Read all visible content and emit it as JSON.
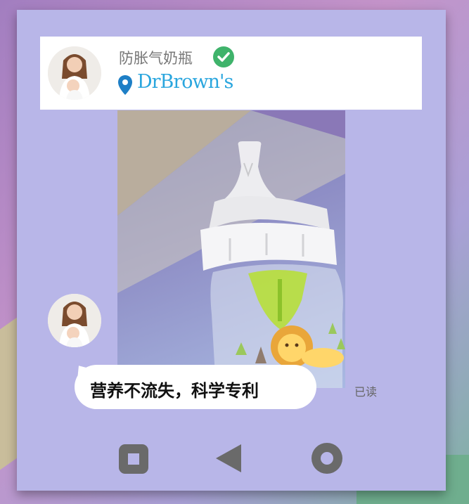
{
  "header": {
    "title": "防胀气奶瓶",
    "brand": "DrBrown's"
  },
  "message": {
    "text": "营养不流失，科学专利",
    "status": "已读"
  },
  "icons": {
    "verified": "check-circle-icon",
    "location": "location-pin-icon",
    "nav": [
      "square-icon",
      "back-triangle-icon",
      "home-circle-icon"
    ]
  },
  "colors": {
    "card_bg": "#b8b6e8",
    "verified": "#3fb36b",
    "brand": "#2aa6de",
    "nav": "#6a6a6a"
  }
}
